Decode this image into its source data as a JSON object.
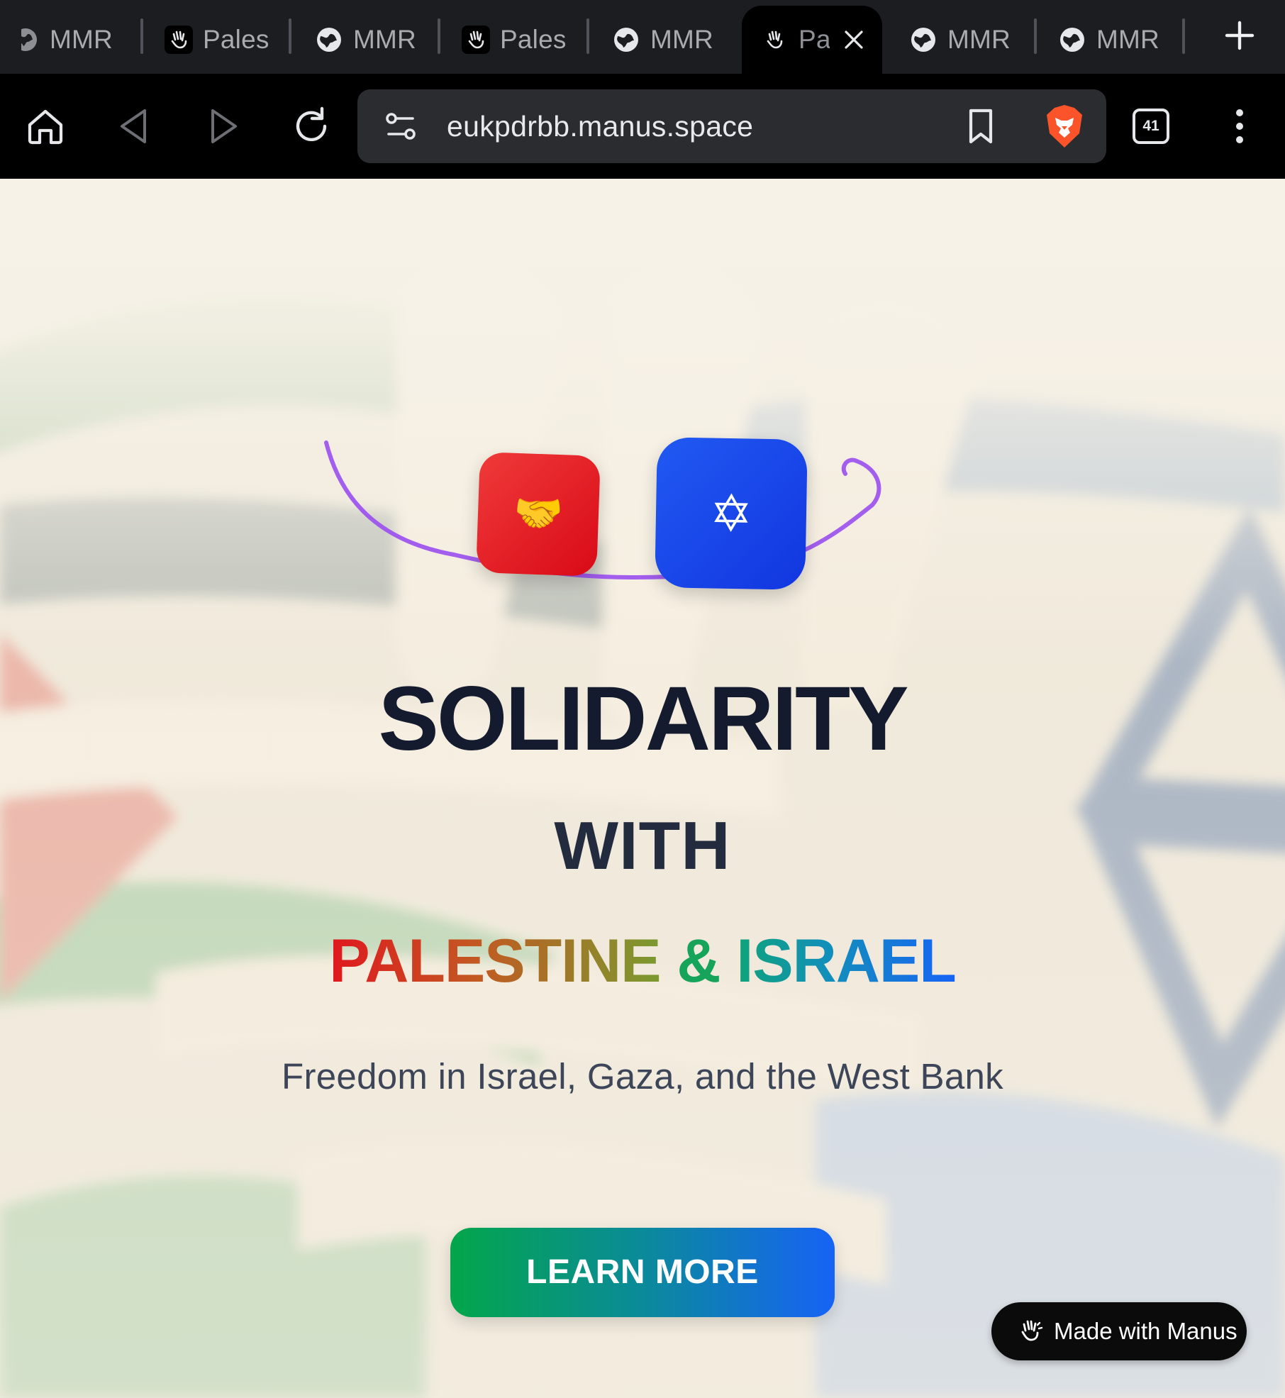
{
  "browser": {
    "tabs": [
      {
        "title": "MMR",
        "icon": "globe-icon",
        "active": false
      },
      {
        "title": "Pales",
        "icon": "manus-hand-icon",
        "active": false
      },
      {
        "title": "MMR",
        "icon": "globe-icon",
        "active": false
      },
      {
        "title": "Pales",
        "icon": "manus-hand-icon",
        "active": false
      },
      {
        "title": "MMR",
        "icon": "globe-icon",
        "active": false
      },
      {
        "title": "Pa",
        "icon": "manus-hand-icon",
        "active": true
      },
      {
        "title": "MMR",
        "icon": "globe-icon",
        "active": false
      },
      {
        "title": "MMR",
        "icon": "globe-icon",
        "active": false
      }
    ],
    "url": "eukpdrbb.manus.space",
    "tab_count": "41",
    "brand_color": "#fb542b"
  },
  "hero": {
    "tile_left_emoji": "🤝",
    "tile_right_emoji": "✡",
    "heading_line1": "SOLIDARITY",
    "heading_line2": "WITH",
    "heading_line3_part1": "PALESTINE",
    "heading_line3_part2": "&",
    "heading_line3_part3": "ISRAEL",
    "subtitle": "Freedom in Israel, Gaza, and the West Bank",
    "cta_label": "LEARN MORE"
  },
  "badge": {
    "label": "Made with Manus"
  },
  "colors": {
    "heading_dark": "#151b2e",
    "gradient_red": "#e0171f",
    "gradient_green": "#02a24a",
    "gradient_blue": "#1763f5",
    "tile_red": "#e8141c",
    "tile_blue": "#1a47ea",
    "annotation_purple": "#9a4ef0"
  }
}
